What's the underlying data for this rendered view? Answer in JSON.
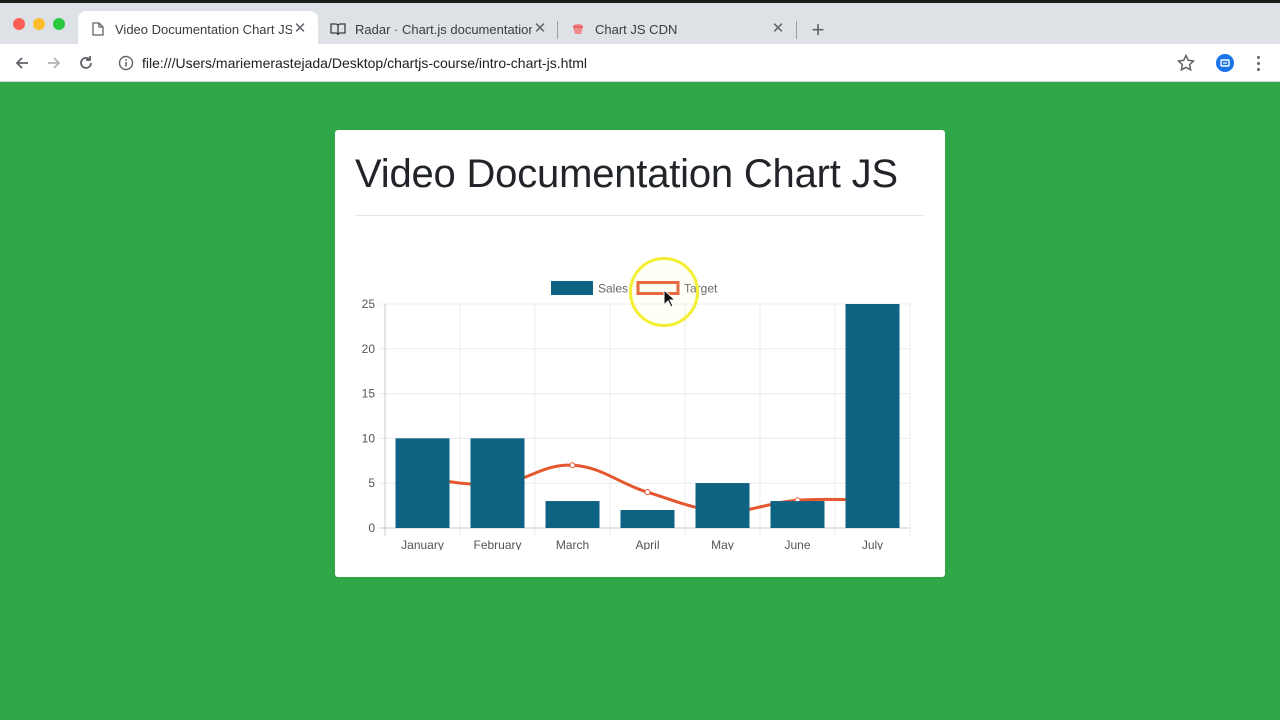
{
  "browser": {
    "tabs": [
      {
        "label": "Video Documentation Chart JS",
        "active": true,
        "icon": "page-icon"
      },
      {
        "label": "Radar · Chart.js documentation",
        "active": false,
        "icon": "book-icon"
      },
      {
        "label": "Chart JS CDN",
        "active": false,
        "icon": "cdn-icon"
      }
    ],
    "url": "file:///Users/mariemerastejada/Desktop/chartjs-course/intro-chart-js.html"
  },
  "page": {
    "title": "Video Documentation Chart JS"
  },
  "colors": {
    "background": "#2fa648",
    "sales": "#0e6282",
    "target": "#e4572e"
  },
  "chart_data": {
    "type": "bar",
    "categories": [
      "January",
      "February",
      "March",
      "April",
      "May",
      "June",
      "July"
    ],
    "series": [
      {
        "name": "Sales",
        "type": "bar",
        "values": [
          10,
          10,
          3,
          2,
          5,
          3,
          25
        ]
      },
      {
        "name": "Target",
        "type": "line",
        "values": [
          5.6,
          4.9,
          7.0,
          4.0,
          1.9,
          3.1,
          3.1
        ]
      }
    ],
    "yticks": [
      0,
      5,
      10,
      15,
      20,
      25
    ],
    "ylim": [
      0,
      25
    ],
    "legend": "top",
    "grid": true
  }
}
